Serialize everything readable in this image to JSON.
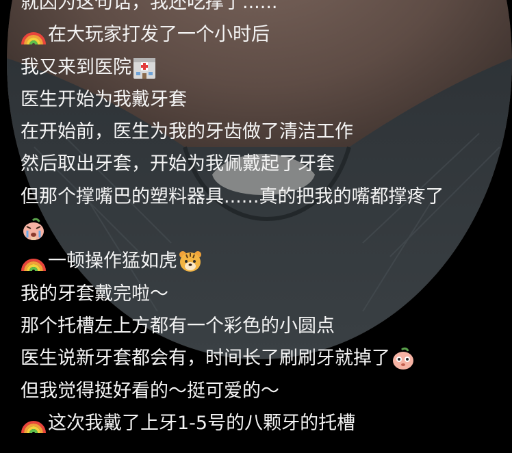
{
  "caption_lines": [
    {
      "text": "就因为这句话，我还吃撑了......",
      "emoji_before": "",
      "emoji_after": ""
    },
    {
      "text": "在大玩家打发了一个小时后",
      "emoji_before": "rainbow-emoji",
      "emoji_after": ""
    },
    {
      "text": "我又来到医院",
      "emoji_before": "",
      "emoji_after": "hospital-emoji"
    },
    {
      "text": "医生开始为我戴牙套",
      "emoji_before": "",
      "emoji_after": ""
    },
    {
      "text": "在开始前，医生为我的牙齿做了清洁工作",
      "emoji_before": "",
      "emoji_after": ""
    },
    {
      "text": "然后取出牙套，开始为我佩戴起了牙套",
      "emoji_before": "",
      "emoji_after": ""
    },
    {
      "text": "但那个撑嘴巴的塑料器具......真的把我的嘴都撑疼了",
      "emoji_before": "",
      "emoji_after": ""
    },
    {
      "text": "",
      "emoji_before": "crying-peach-emoji",
      "emoji_after": ""
    },
    {
      "text": "一顿操作猛如虎",
      "emoji_before": "rainbow-emoji",
      "emoji_after": "tiger-face-emoji"
    },
    {
      "text": "我的牙套戴完啦～",
      "emoji_before": "",
      "emoji_after": ""
    },
    {
      "text": "那个托槽左上方都有一个彩色的小圆点",
      "emoji_before": "",
      "emoji_after": ""
    },
    {
      "text": "医生说新牙套都会有，时间长了刷刷牙就掉了",
      "emoji_before": "",
      "emoji_after": "peach-face-emoji"
    },
    {
      "text": "但我觉得挺好看的～挺可爱的～",
      "emoji_before": "",
      "emoji_after": ""
    },
    {
      "text": "这次我戴了上牙1-5号的八颗牙的托槽",
      "emoji_before": "rainbow-emoji",
      "emoji_after": ""
    }
  ],
  "colors": {
    "text": "#f4f4f4",
    "background": "#000000",
    "photo_shirt": "#363c40",
    "photo_skin": "#6e5a52"
  }
}
